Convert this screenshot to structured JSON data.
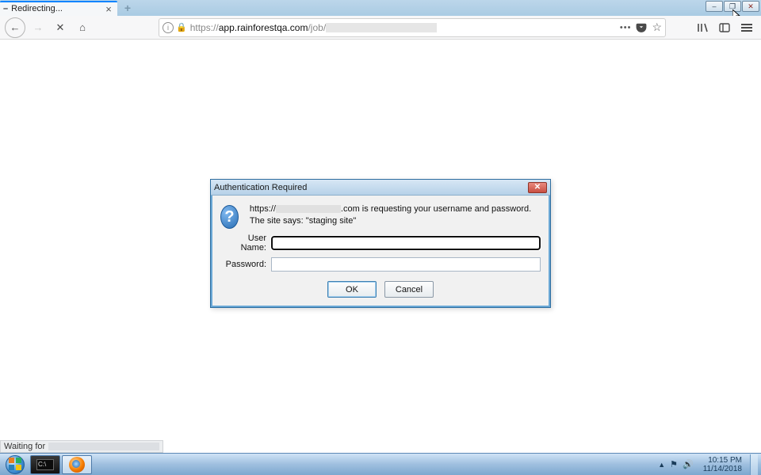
{
  "window": {
    "tab_title": "Redirecting...",
    "close_glyph": "×",
    "newtab_glyph": "+",
    "minimize_glyph": "–",
    "maximize_glyph": "❐",
    "winclose_glyph": "✕"
  },
  "nav": {
    "back_glyph": "←",
    "forward_glyph": "→",
    "stop_glyph": "✕",
    "home_glyph": "⌂",
    "info_glyph": "i",
    "lock_glyph": "🔒",
    "url_prefix": "https://",
    "url_host": "app.rainforestqa.com",
    "url_path": "/job/",
    "dots": "•••",
    "star_glyph": "☆"
  },
  "dialog": {
    "title": "Authentication Required",
    "close_glyph": "✕",
    "msg_pre": "https://",
    "msg_post": ".com is requesting your username and password. The site says: \"staging site\"",
    "username_label": "User Name:",
    "password_label": "Password:",
    "username_value": "",
    "password_value": "",
    "ok_label": "OK",
    "cancel_label": "Cancel",
    "question_glyph": "?"
  },
  "status": {
    "waiting": "Waiting for"
  },
  "taskbar": {
    "terminal_text": "C:\\",
    "tray_up": "▲",
    "tray_flag": "⚑",
    "tray_speaker": "🔊",
    "time": "10:15 PM",
    "date": "11/14/2018"
  }
}
